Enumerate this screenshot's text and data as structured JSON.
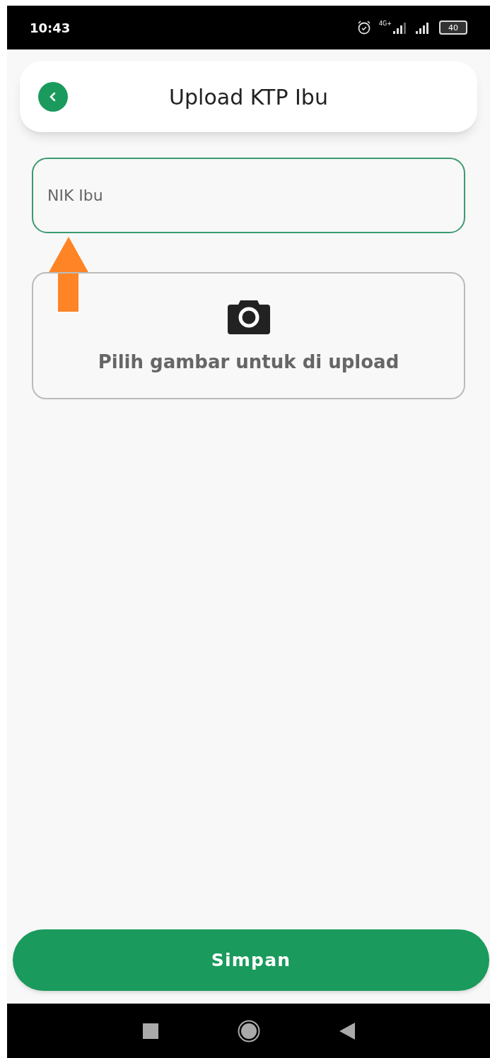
{
  "status_bar": {
    "time": "10:43",
    "network": "4G+",
    "battery": "40"
  },
  "header": {
    "title": "Upload KTP Ibu"
  },
  "nik_field": {
    "placeholder": "NIK Ibu",
    "focused": true
  },
  "upload": {
    "label": "Pilih gambar untuk di upload"
  },
  "save_button": {
    "label": "Simpan"
  }
}
